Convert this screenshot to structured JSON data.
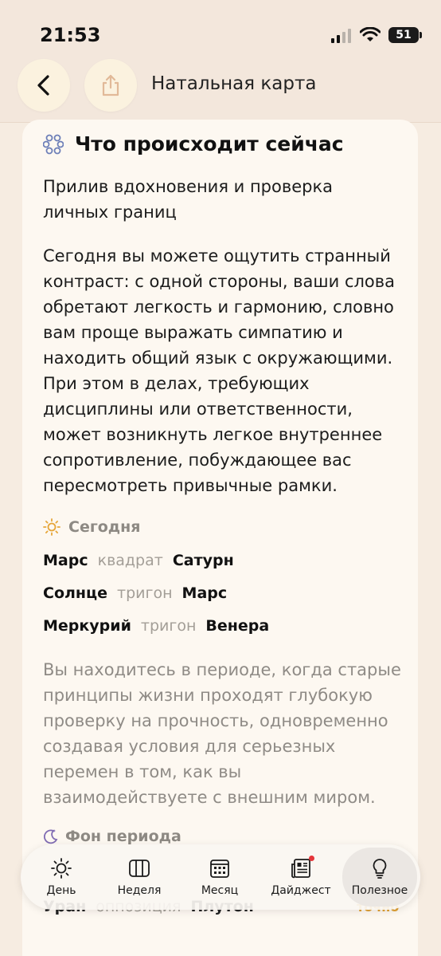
{
  "status_bar": {
    "time": "21:53",
    "battery": "51"
  },
  "header": {
    "title": "Натальная карта"
  },
  "section": {
    "title": "Что происходит сейчас",
    "subtitle": "Прилив вдохновения и проверка личных границ",
    "paragraph": "Сегодня вы можете ощутить странный контраст: с одной стороны, ваши слова обретают легкость и гармонию, словно вам проще выражать симпатию и находить общий язык с окружающими. При этом в делах, требующих дисциплины или ответственности, может возникнуть легкое внутреннее сопротивление, побуждающее вас пересмотреть привычные рамки."
  },
  "today": {
    "label": "Сегодня",
    "aspects": [
      {
        "planet1": "Марс",
        "kind": "квадрат",
        "planet2": "Сатурн"
      },
      {
        "planet1": "Солнце",
        "kind": "тригон",
        "planet2": "Марс"
      },
      {
        "planet1": "Меркурий",
        "kind": "тригон",
        "planet2": "Венера"
      }
    ],
    "paragraph": "Вы находитесь в периоде, когда старые принципы жизни проходят глубокую проверку на прочность, одновременно создавая условия для серьезных перемен в том, как вы взаимодействуете с внешним миром."
  },
  "period": {
    "label": "Фон периода",
    "partial_row": {
      "planet1": "Уран",
      "kind": "оппозиция",
      "planet2": "Плутон",
      "accuracy": "точно"
    }
  },
  "tabbar": {
    "tabs": [
      {
        "label": "День",
        "icon": "sun-icon"
      },
      {
        "label": "Неделя",
        "icon": "week-columns-icon"
      },
      {
        "label": "Месяц",
        "icon": "calendar-icon"
      },
      {
        "label": "Дайджест",
        "icon": "newspaper-icon"
      },
      {
        "label": "Полезное",
        "icon": "lightbulb-icon"
      }
    ],
    "active": "Полезное"
  },
  "colors": {
    "background": "#f6ece1",
    "card": "#fdf8f1",
    "muted_text": "#8f8b86",
    "accent_orange": "#e0a033",
    "badge_red": "#e5353a"
  }
}
